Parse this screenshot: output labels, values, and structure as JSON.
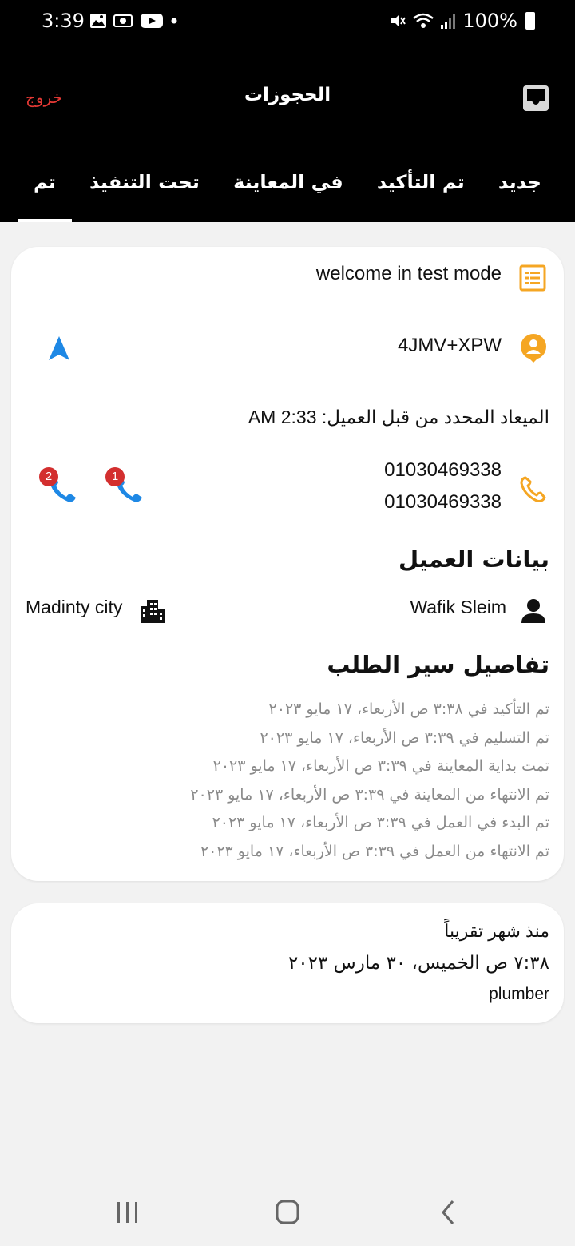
{
  "status_bar": {
    "time": "3:39",
    "battery": "100%"
  },
  "header": {
    "title": "الحجوزات",
    "logout_label": "خروج",
    "tabs": [
      {
        "label": "جديد"
      },
      {
        "label": "تم التأكيد"
      },
      {
        "label": "في المعاينة"
      },
      {
        "label": "تحت التنفيذ"
      },
      {
        "label": "تم",
        "active": true
      }
    ]
  },
  "booking": {
    "service_title": "welcome in test mode",
    "location_code": "4JMV+XPW",
    "scheduled_time_label": "الميعاد المحدد من قبل العميل: 2:33 AM",
    "phones": [
      "01030469338",
      "01030469338"
    ],
    "call_badges": [
      "1",
      "2"
    ],
    "customer_section_title": "بيانات العميل",
    "customer_name": "Wafik Sleim",
    "customer_city": "Madinty city",
    "timeline_title": "تفاصيل سير الطلب",
    "timeline": [
      "تم التأكيد في  ٣:٣٨ ص الأربعاء، ١٧ مايو ٢٠٢٣",
      "تم التسليم في ٣:٣٩ ص الأربعاء، ١٧ مايو ٢٠٢٣",
      "تمت بداية المعاينة في ٣:٣٩ ص الأربعاء، ١٧ مايو ٢٠٢٣",
      "تم الانتهاء من المعاينة في ٣:٣٩ ص الأربعاء، ١٧ مايو ٢٠٢٣",
      "تم البدء في العمل في ٣:٣٩ ص الأربعاء، ١٧ مايو ٢٠٢٣",
      "تم الانتهاء من العمل في ٣:٣٩ ص الأربعاء، ١٧ مايو ٢٠٢٣"
    ]
  },
  "booking2": {
    "relative_time": "منذ شهر تقريباً",
    "date_time": "٧:٣٨ ص الخميس، ٣٠ مارس ٢٠٢٣",
    "service": "plumber"
  },
  "colors": {
    "accent_orange": "#f5a623",
    "call_blue": "#1e88e5",
    "badge_red": "#d32f2f",
    "logout_red": "#e53935"
  }
}
